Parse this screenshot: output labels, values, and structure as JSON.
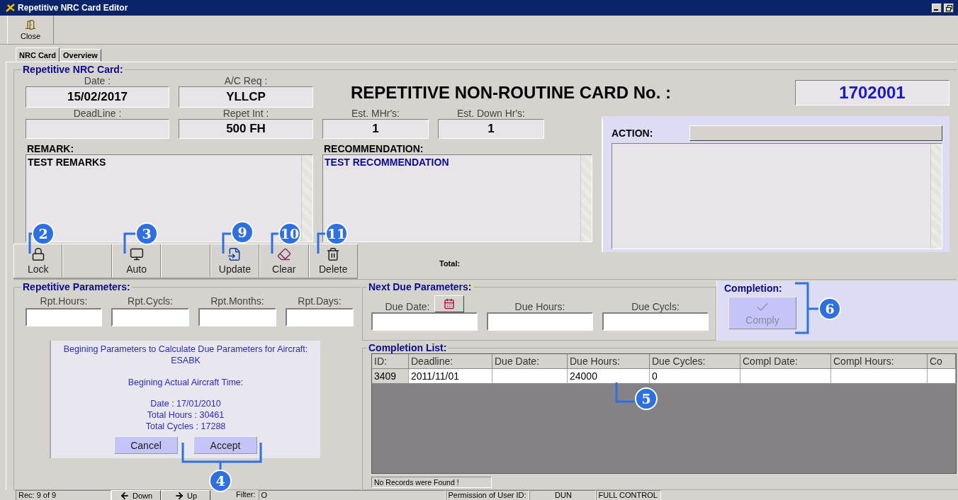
{
  "window": {
    "title": "Repetitive NRC Card Editor"
  },
  "toolbar": [
    {
      "label": "Close",
      "kind": "close"
    }
  ],
  "tabs": [
    {
      "label": "NRC Card",
      "selected": true
    },
    {
      "label": "Overview",
      "selected": false
    }
  ],
  "card": {
    "title": "Repetitive NRC Card:",
    "heading": "REPETITIVE NON-ROUTINE CARD No. :",
    "card_number": "1702001",
    "field_rows": [
      [
        {
          "label": "Date :",
          "value": "15/02/2017"
        },
        {
          "label": "A/C Req :",
          "value": "YLLCP"
        }
      ],
      [
        {
          "label": "DeadLine :"
        },
        {
          "label": "Repet Int :",
          "value": "500 FH"
        },
        {
          "label": "Est. MHr's:",
          "value": "1"
        },
        {
          "label": "Est. Down Hr's:",
          "value": "1"
        }
      ]
    ],
    "remark": {
      "label": "REMARK:",
      "text": "TEST REMARKS"
    },
    "recommendation": {
      "label": "RECOMMENDATION:",
      "text": "TEST RECOMMENDATION"
    },
    "action": {
      "label": "ACTION:"
    }
  },
  "actions": [
    {
      "label": "Lock",
      "kind": "lock"
    },
    {
      "kind": "blank"
    },
    {
      "label": "Auto",
      "kind": "auto"
    },
    {
      "kind": "blank"
    },
    {
      "label": "Update",
      "kind": "update"
    },
    {
      "label": "Clear",
      "kind": "clear"
    },
    {
      "label": "Delete",
      "kind": "delete"
    }
  ],
  "total_label": "Total:",
  "repetitive_parameters": {
    "title": "Repetitive Parameters:",
    "fields": [
      {
        "label": "Rpt.Hours:"
      },
      {
        "label": "Rpt.Cycls:"
      },
      {
        "label": "Rpt.Months:"
      },
      {
        "label": "Rpt.Days:"
      }
    ]
  },
  "begin_panel": {
    "heading": "Begining Parameters to Calculate Due Parameters for Aircraft:",
    "aircraft": "ESABK",
    "time_heading": "Begining Actual Aircraft Time:",
    "details": [
      "Date : 17/01/2010",
      "Total Hours : 30461",
      "Total Cycles : 17288"
    ],
    "buttons": [
      "Cancel",
      "Accept"
    ]
  },
  "next_due": {
    "title": "Next Due Parameters:",
    "fields": [
      {
        "label": "Due Date:",
        "kind": "date"
      },
      {
        "label": "Due Hours:",
        "kind": "number"
      },
      {
        "label": "Due Cycls:",
        "kind": "number"
      }
    ]
  },
  "completion": {
    "title": "Completion:",
    "button": {
      "label": "Comply",
      "disabled": true
    }
  },
  "completion_list": {
    "title": "Completion List:",
    "columns": [
      "ID:",
      "Deadline:",
      "Due Date:",
      "Due Hours:",
      "Due Cycles:",
      "Compl Date:",
      "Compl Hours:",
      "Co"
    ],
    "rows": [
      [
        "3409",
        "2011/11/01",
        null,
        "24000",
        "0",
        null,
        null,
        null
      ]
    ],
    "status": "No Records were Found !"
  },
  "status_bar": {
    "record": "Rec: 9 of 9",
    "down": "Down",
    "up": "Up",
    "filter_label": "Filter:",
    "filter_value": "O",
    "permission_label": "Permission of User ID:",
    "user": "DUN",
    "permission": "FULL CONTROL"
  },
  "callouts": [
    {
      "number": "2"
    },
    {
      "number": "3"
    },
    {
      "number": "9"
    },
    {
      "number": "10"
    },
    {
      "number": "11"
    },
    {
      "number": "6"
    },
    {
      "number": "5"
    },
    {
      "number": "4"
    }
  ]
}
